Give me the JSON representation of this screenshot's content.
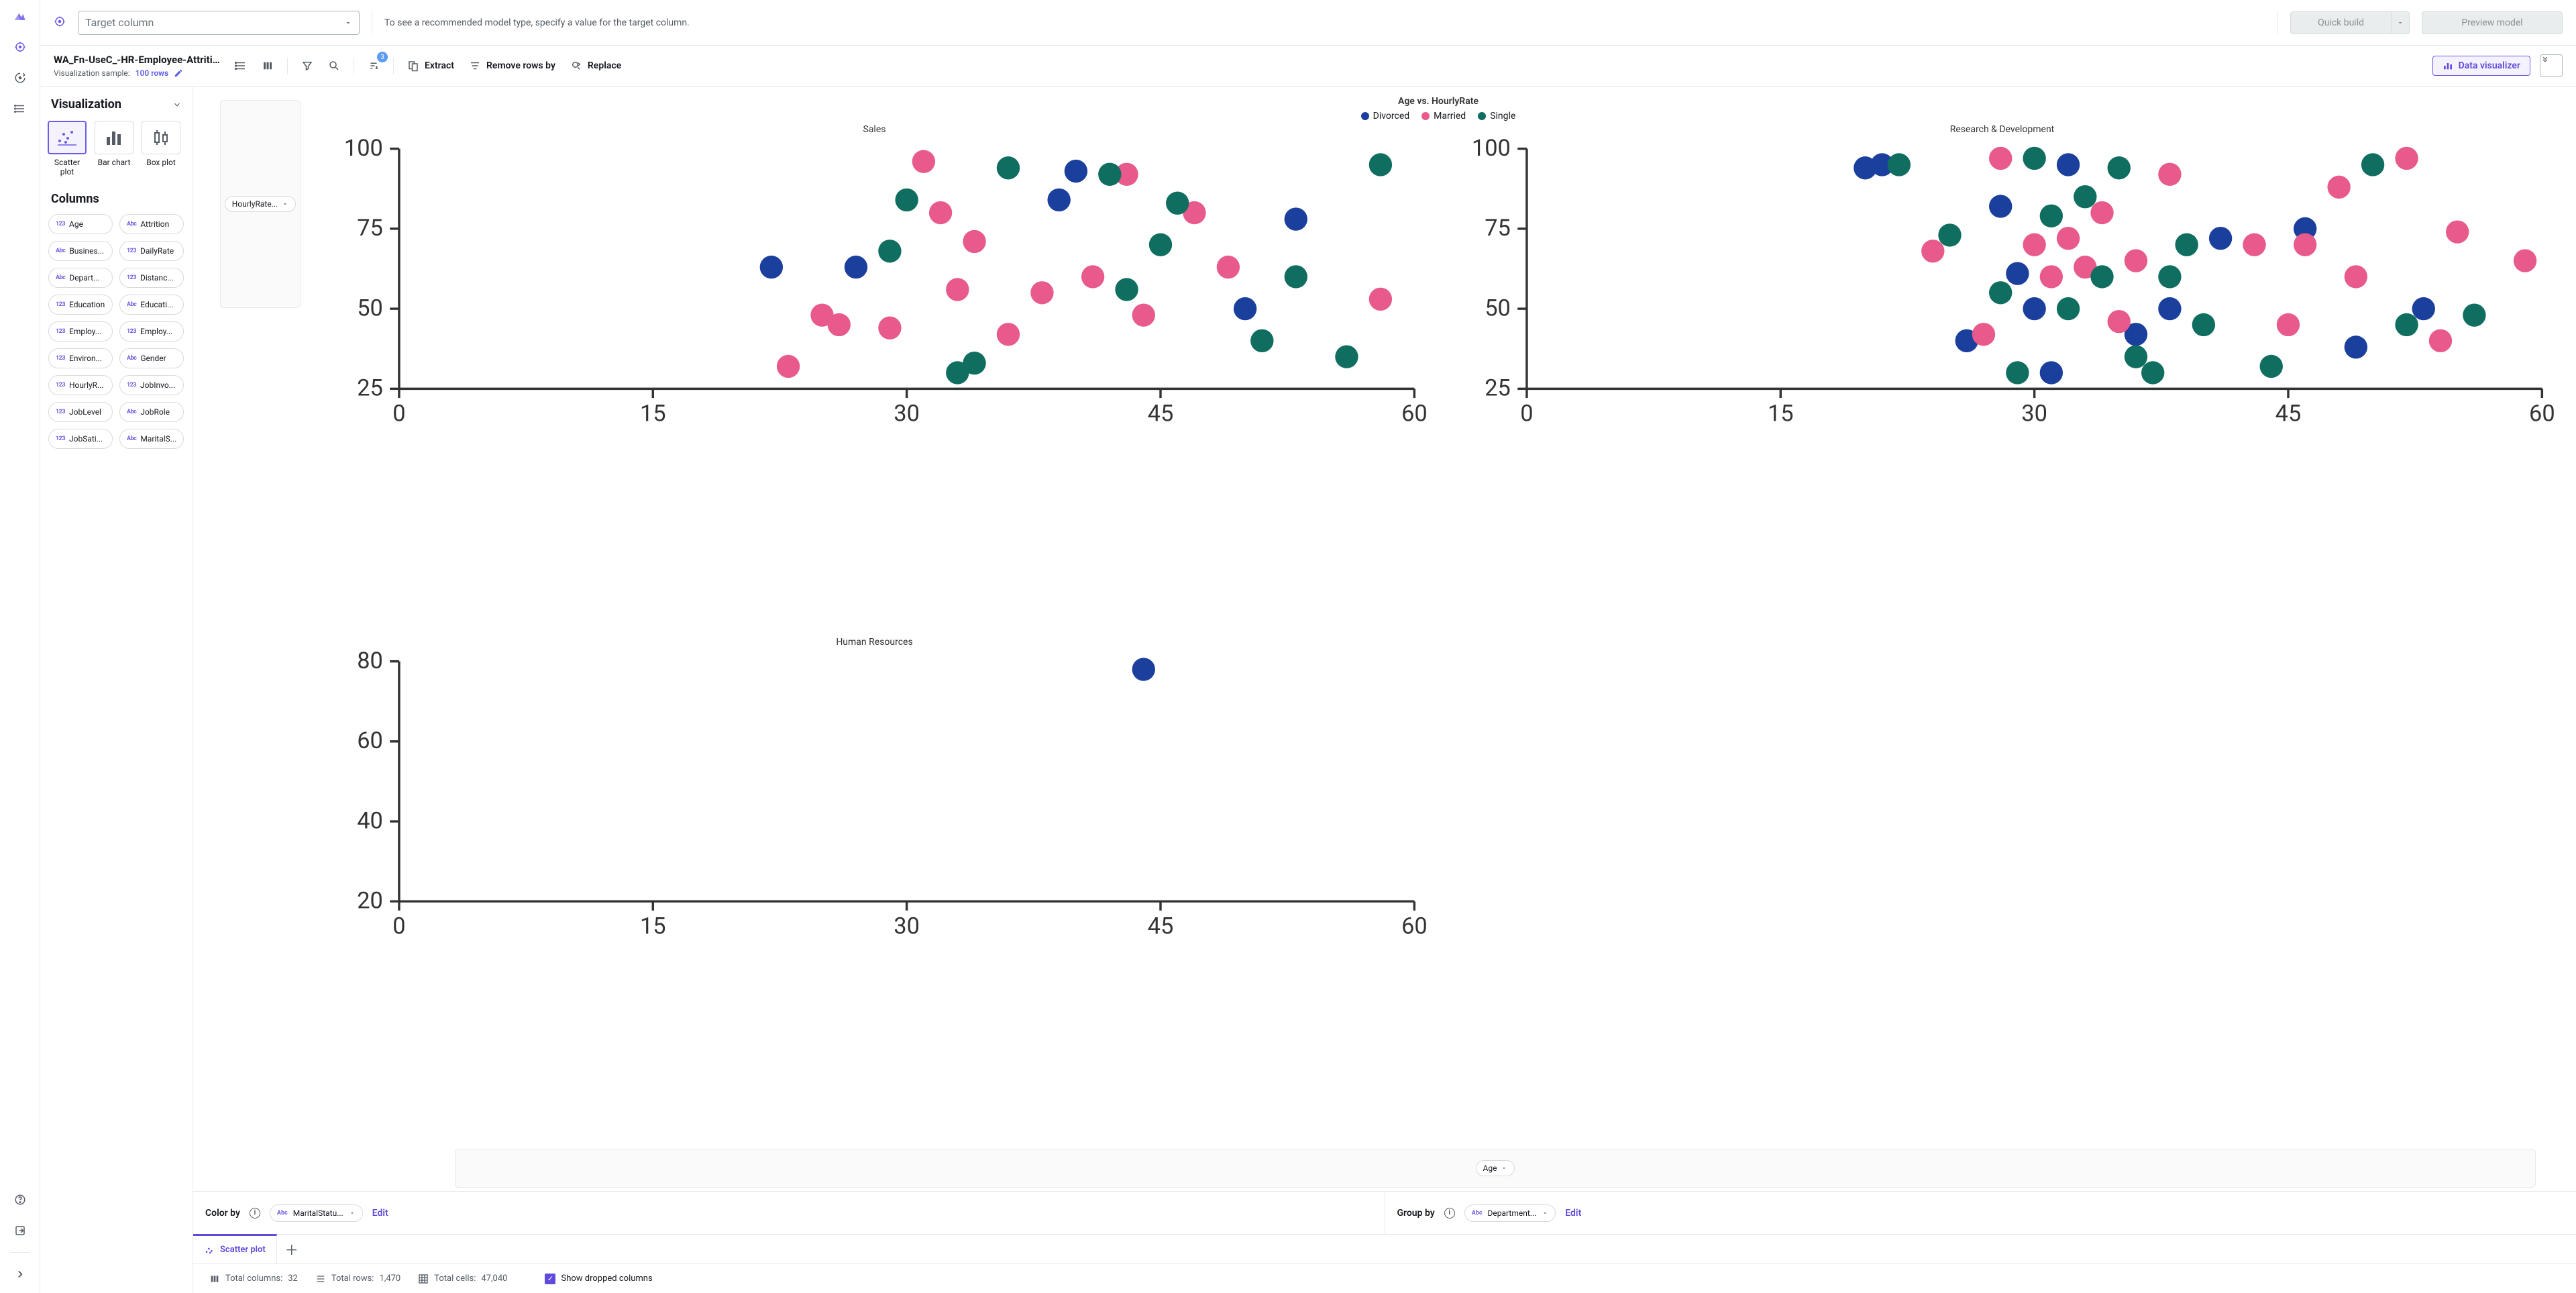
{
  "leftbar": {
    "items": [
      "logo",
      "target",
      "autopilot",
      "list",
      "help",
      "export",
      "expand"
    ]
  },
  "topbar": {
    "target_placeholder": "Target column",
    "hint": "To see a recommended model type, specify a value for the target column.",
    "quick_build": "Quick build",
    "preview_model": "Preview model"
  },
  "subbar": {
    "dataset_title": "WA_Fn-UseC_-HR-Employee-Attrition...",
    "sample_label": "Visualization sample:",
    "sample_value": "100 rows",
    "tools": {
      "extract": "Extract",
      "remove": "Remove rows by",
      "replace": "Replace"
    },
    "sort_badge": "3",
    "dv_button": "Data visualizer"
  },
  "viz_panel": {
    "heading": "Visualization",
    "types": [
      {
        "label": "Scatter plot",
        "selected": true
      },
      {
        "label": "Bar chart",
        "selected": false
      },
      {
        "label": "Box plot",
        "selected": false
      }
    ],
    "columns_heading": "Columns",
    "columns": [
      {
        "type": "123",
        "name": "Age"
      },
      {
        "type": "Abc",
        "name": "Attrition"
      },
      {
        "type": "Abc",
        "name": "Busines..."
      },
      {
        "type": "123",
        "name": "DailyRate"
      },
      {
        "type": "Abc",
        "name": "Depart..."
      },
      {
        "type": "123",
        "name": "Distanc..."
      },
      {
        "type": "123",
        "name": "Education"
      },
      {
        "type": "Abc",
        "name": "Educati..."
      },
      {
        "type": "123",
        "name": "Employ..."
      },
      {
        "type": "123",
        "name": "Employ..."
      },
      {
        "type": "123",
        "name": "Environ..."
      },
      {
        "type": "Abc",
        "name": "Gender"
      },
      {
        "type": "123",
        "name": "HourlyR..."
      },
      {
        "type": "123",
        "name": "JobInvo..."
      },
      {
        "type": "123",
        "name": "JobLevel"
      },
      {
        "type": "Abc",
        "name": "JobRole"
      },
      {
        "type": "123",
        "name": "JobSati..."
      },
      {
        "type": "Abc",
        "name": "MaritalS..."
      }
    ]
  },
  "chart": {
    "title": "Age vs. HourlyRate",
    "legend": [
      {
        "label": "Divorced",
        "color": "#1b3f9c"
      },
      {
        "label": "Married",
        "color": "#e85a8b"
      },
      {
        "label": "Single",
        "color": "#0f6e5f"
      }
    ],
    "y_axis_pill": "HourlyRate...",
    "x_axis_pill": "Age",
    "facets": [
      "Sales",
      "Research & Development",
      "Human Resources"
    ]
  },
  "controls": {
    "color_by_label": "Color by",
    "color_by_value": "MaritalStatu...",
    "group_by_label": "Group by",
    "group_by_value": "Department...",
    "edit": "Edit"
  },
  "tabbar": {
    "tab1": "Scatter plot"
  },
  "statusbar": {
    "cols_label": "Total columns:",
    "cols_val": "32",
    "rows_label": "Total rows:",
    "rows_val": "1,470",
    "cells_label": "Total cells:",
    "cells_val": "47,040",
    "show_dropped": "Show dropped columns"
  },
  "chart_data": {
    "type": "scatter",
    "title": "Age vs. HourlyRate",
    "xlabel": "Age",
    "ylabel": "HourlyRate",
    "color_by": "MaritalStatus",
    "group_by": "Department",
    "color_levels": {
      "Divorced": "#1b3f9c",
      "Married": "#e85a8b",
      "Single": "#0f6e5f"
    },
    "facets": [
      {
        "name": "Sales",
        "xlim": [
          0,
          60
        ],
        "ylim": [
          25,
          100
        ],
        "xticks": [
          0,
          15,
          30,
          45,
          60
        ],
        "yticks": [
          25,
          50,
          75,
          100
        ],
        "points": [
          {
            "x": 22,
            "y": 63,
            "c": "Divorced"
          },
          {
            "x": 27,
            "y": 63,
            "c": "Divorced"
          },
          {
            "x": 39,
            "y": 84,
            "c": "Divorced"
          },
          {
            "x": 40,
            "y": 93,
            "c": "Divorced"
          },
          {
            "x": 50,
            "y": 50,
            "c": "Divorced"
          },
          {
            "x": 53,
            "y": 78,
            "c": "Divorced"
          },
          {
            "x": 23,
            "y": 32,
            "c": "Married"
          },
          {
            "x": 25,
            "y": 48,
            "c": "Married"
          },
          {
            "x": 26,
            "y": 45,
            "c": "Married"
          },
          {
            "x": 29,
            "y": 44,
            "c": "Married"
          },
          {
            "x": 31,
            "y": 96,
            "c": "Married"
          },
          {
            "x": 32,
            "y": 80,
            "c": "Married"
          },
          {
            "x": 33,
            "y": 56,
            "c": "Married"
          },
          {
            "x": 34,
            "y": 71,
            "c": "Married"
          },
          {
            "x": 36,
            "y": 42,
            "c": "Married"
          },
          {
            "x": 38,
            "y": 55,
            "c": "Married"
          },
          {
            "x": 41,
            "y": 60,
            "c": "Married"
          },
          {
            "x": 43,
            "y": 92,
            "c": "Married"
          },
          {
            "x": 44,
            "y": 48,
            "c": "Married"
          },
          {
            "x": 47,
            "y": 80,
            "c": "Married"
          },
          {
            "x": 49,
            "y": 63,
            "c": "Married"
          },
          {
            "x": 58,
            "y": 53,
            "c": "Married"
          },
          {
            "x": 29,
            "y": 68,
            "c": "Single"
          },
          {
            "x": 30,
            "y": 84,
            "c": "Single"
          },
          {
            "x": 33,
            "y": 30,
            "c": "Single"
          },
          {
            "x": 34,
            "y": 33,
            "c": "Single"
          },
          {
            "x": 36,
            "y": 94,
            "c": "Single"
          },
          {
            "x": 42,
            "y": 92,
            "c": "Single"
          },
          {
            "x": 43,
            "y": 56,
            "c": "Single"
          },
          {
            "x": 45,
            "y": 70,
            "c": "Single"
          },
          {
            "x": 46,
            "y": 83,
            "c": "Single"
          },
          {
            "x": 51,
            "y": 40,
            "c": "Single"
          },
          {
            "x": 53,
            "y": 60,
            "c": "Single"
          },
          {
            "x": 56,
            "y": 35,
            "c": "Single"
          },
          {
            "x": 58,
            "y": 95,
            "c": "Single"
          }
        ]
      },
      {
        "name": "Research & Development",
        "xlim": [
          0,
          60
        ],
        "ylim": [
          25,
          100
        ],
        "xticks": [
          0,
          15,
          30,
          45,
          60
        ],
        "yticks": [
          25,
          50,
          75,
          100
        ],
        "points": [
          {
            "x": 20,
            "y": 94,
            "c": "Divorced"
          },
          {
            "x": 21,
            "y": 95,
            "c": "Divorced"
          },
          {
            "x": 26,
            "y": 40,
            "c": "Divorced"
          },
          {
            "x": 28,
            "y": 82,
            "c": "Divorced"
          },
          {
            "x": 29,
            "y": 61,
            "c": "Divorced"
          },
          {
            "x": 30,
            "y": 50,
            "c": "Divorced"
          },
          {
            "x": 31,
            "y": 30,
            "c": "Divorced"
          },
          {
            "x": 32,
            "y": 95,
            "c": "Divorced"
          },
          {
            "x": 36,
            "y": 42,
            "c": "Divorced"
          },
          {
            "x": 38,
            "y": 50,
            "c": "Divorced"
          },
          {
            "x": 41,
            "y": 72,
            "c": "Divorced"
          },
          {
            "x": 46,
            "y": 75,
            "c": "Divorced"
          },
          {
            "x": 49,
            "y": 38,
            "c": "Divorced"
          },
          {
            "x": 53,
            "y": 50,
            "c": "Divorced"
          },
          {
            "x": 24,
            "y": 68,
            "c": "Married"
          },
          {
            "x": 27,
            "y": 42,
            "c": "Married"
          },
          {
            "x": 28,
            "y": 97,
            "c": "Married"
          },
          {
            "x": 30,
            "y": 70,
            "c": "Married"
          },
          {
            "x": 31,
            "y": 60,
            "c": "Married"
          },
          {
            "x": 32,
            "y": 72,
            "c": "Married"
          },
          {
            "x": 33,
            "y": 63,
            "c": "Married"
          },
          {
            "x": 34,
            "y": 80,
            "c": "Married"
          },
          {
            "x": 35,
            "y": 46,
            "c": "Married"
          },
          {
            "x": 36,
            "y": 65,
            "c": "Married"
          },
          {
            "x": 38,
            "y": 92,
            "c": "Married"
          },
          {
            "x": 43,
            "y": 70,
            "c": "Married"
          },
          {
            "x": 45,
            "y": 45,
            "c": "Married"
          },
          {
            "x": 46,
            "y": 70,
            "c": "Married"
          },
          {
            "x": 48,
            "y": 88,
            "c": "Married"
          },
          {
            "x": 49,
            "y": 60,
            "c": "Married"
          },
          {
            "x": 52,
            "y": 97,
            "c": "Married"
          },
          {
            "x": 54,
            "y": 40,
            "c": "Married"
          },
          {
            "x": 55,
            "y": 74,
            "c": "Married"
          },
          {
            "x": 59,
            "y": 65,
            "c": "Married"
          },
          {
            "x": 22,
            "y": 95,
            "c": "Single"
          },
          {
            "x": 25,
            "y": 73,
            "c": "Single"
          },
          {
            "x": 28,
            "y": 55,
            "c": "Single"
          },
          {
            "x": 29,
            "y": 30,
            "c": "Single"
          },
          {
            "x": 30,
            "y": 97,
            "c": "Single"
          },
          {
            "x": 31,
            "y": 79,
            "c": "Single"
          },
          {
            "x": 32,
            "y": 50,
            "c": "Single"
          },
          {
            "x": 33,
            "y": 85,
            "c": "Single"
          },
          {
            "x": 34,
            "y": 60,
            "c": "Single"
          },
          {
            "x": 35,
            "y": 94,
            "c": "Single"
          },
          {
            "x": 36,
            "y": 35,
            "c": "Single"
          },
          {
            "x": 37,
            "y": 30,
            "c": "Single"
          },
          {
            "x": 38,
            "y": 60,
            "c": "Single"
          },
          {
            "x": 39,
            "y": 70,
            "c": "Single"
          },
          {
            "x": 40,
            "y": 45,
            "c": "Single"
          },
          {
            "x": 44,
            "y": 32,
            "c": "Single"
          },
          {
            "x": 50,
            "y": 95,
            "c": "Single"
          },
          {
            "x": 52,
            "y": 45,
            "c": "Single"
          },
          {
            "x": 56,
            "y": 48,
            "c": "Single"
          }
        ]
      },
      {
        "name": "Human Resources",
        "xlim": [
          0,
          60
        ],
        "ylim": [
          20,
          80
        ],
        "xticks": [
          0,
          15,
          30,
          45,
          60
        ],
        "yticks": [
          20,
          40,
          60,
          80
        ],
        "points": [
          {
            "x": 44,
            "y": 78,
            "c": "Divorced"
          }
        ]
      }
    ]
  }
}
